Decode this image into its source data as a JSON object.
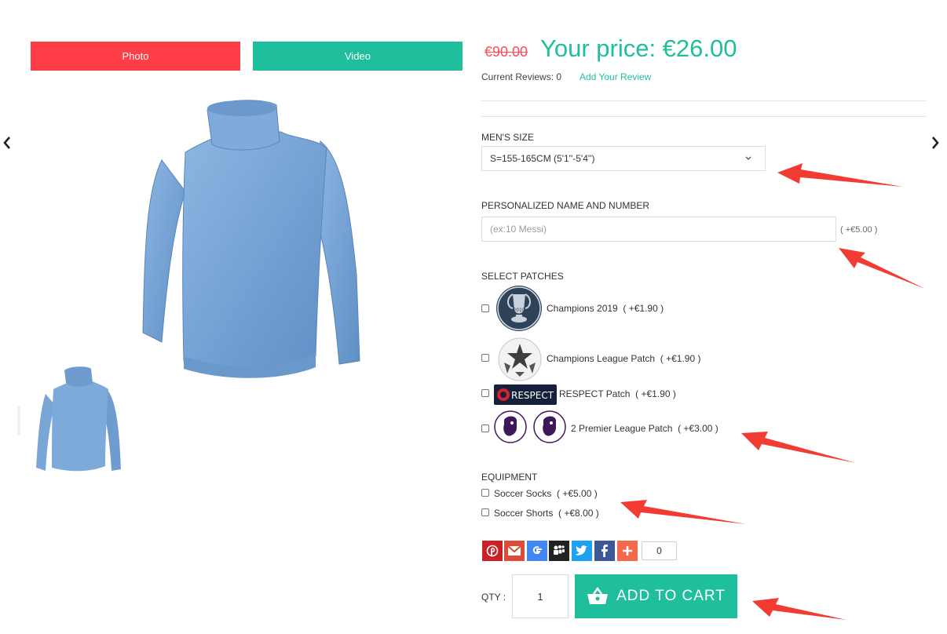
{
  "tabs": {
    "photo": "Photo",
    "video": "Video"
  },
  "price": {
    "old": "€90.00",
    "current": "Your price: €26.00"
  },
  "reviews": {
    "label": "Current Reviews: 0",
    "add": "Add Your Review"
  },
  "size": {
    "label": "MEN'S SIZE",
    "selected": "S=155-165CM (5'1''-5'4'')"
  },
  "personalize": {
    "label": "PERSONALIZED NAME AND NUMBER",
    "placeholder": "(ex:10 Messi)",
    "price": "( +€5.00 )"
  },
  "patches": {
    "label": "SELECT PATCHES",
    "items": [
      {
        "name": "Champions 2019",
        "price": "( +€1.90 )",
        "icon": "champions-2019-badge"
      },
      {
        "name": "Champions League Patch",
        "price": "( +€1.90 )",
        "icon": "starball-badge"
      },
      {
        "name": "RESPECT Patch",
        "price": "( +€1.90 )",
        "icon": "respect-badge",
        "icon_text": "RESPECT"
      },
      {
        "name": "2 Premier League Patch",
        "price": "( +€3.00 )",
        "icon": "premier-league-badge"
      }
    ]
  },
  "equipment": {
    "label": "EQUIPMENT",
    "items": [
      {
        "name": "Soccer Socks",
        "price": "( +€5.00 )"
      },
      {
        "name": "Soccer Shorts",
        "price": "( +€8.00 )"
      }
    ]
  },
  "share": {
    "buttons": [
      {
        "name": "pinterest",
        "icon": "pinterest-icon",
        "color": "#cb2027"
      },
      {
        "name": "gmail",
        "icon": "gmail-icon",
        "color": "#dd4b39"
      },
      {
        "name": "google",
        "icon": "google-icon",
        "color": "#4285f4"
      },
      {
        "name": "myspace",
        "icon": "myspace-icon",
        "color": "#222222"
      },
      {
        "name": "twitter",
        "icon": "twitter-icon",
        "color": "#1da1f2"
      },
      {
        "name": "facebook",
        "icon": "facebook-icon",
        "color": "#3b5998"
      },
      {
        "name": "more",
        "icon": "plus-icon",
        "color": "#f4694b"
      }
    ],
    "count": "0"
  },
  "cart": {
    "qty_label": "QTY :",
    "qty_value": "1",
    "button": "ADD TO CART"
  },
  "colors": {
    "accent": "#1fbf9d",
    "photo_tab": "#ff3d47",
    "old_price": "#ff4a56",
    "annotation": "#f23b33",
    "sweater": "#7aa6d6"
  }
}
